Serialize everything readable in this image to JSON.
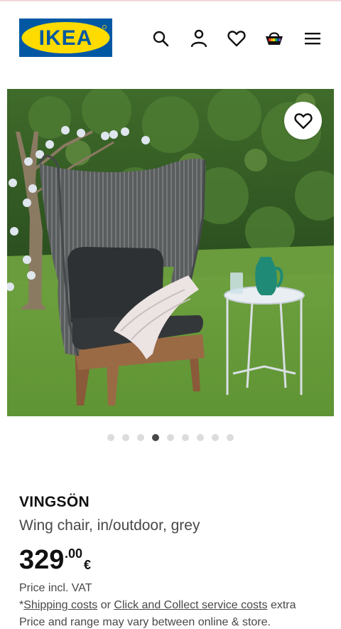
{
  "brand": {
    "logo_text": "IKEA",
    "logo_bg": "#0058a3",
    "logo_yellow": "#ffdb00"
  },
  "header": {
    "icons": [
      "search-icon",
      "profile-icon",
      "favourites-icon",
      "shopping-basket-icon",
      "menu-icon"
    ]
  },
  "gallery": {
    "image_count": 9,
    "active_index": 4,
    "favourite_icon": "heart-outline-icon"
  },
  "product": {
    "name": "VINGSÖN",
    "description": "Wing chair, in/outdoor, grey",
    "price_integer": "329",
    "price_decimal": ".00",
    "currency": "€",
    "vat_note": "Price incl. VAT",
    "shipping_prefix": "*",
    "shipping_link": "Shipping costs",
    "shipping_or": " or ",
    "click_collect_link": "Click and Collect service costs",
    "shipping_suffix": " extra",
    "range_note": "Price and range may vary between online & store."
  }
}
